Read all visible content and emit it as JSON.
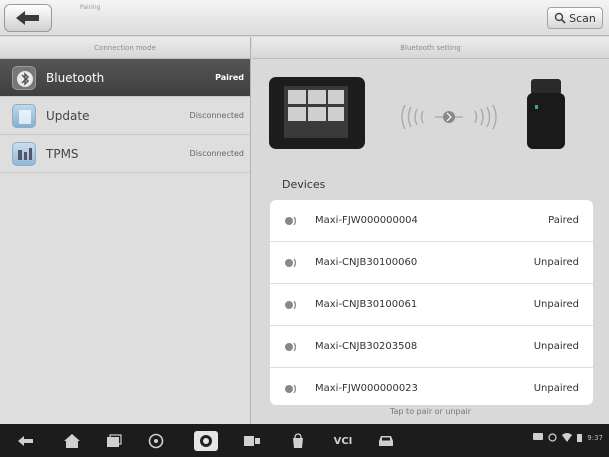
{
  "header": {
    "title": "Pairing",
    "scan_label": "Scan"
  },
  "left_panel": {
    "column_title": "Connection mode",
    "items": [
      {
        "label": "Bluetooth",
        "status": "Paired",
        "icon": "bluetooth-icon",
        "active": true
      },
      {
        "label": "Update",
        "status": "Disconnected",
        "icon": "update-icon",
        "active": false
      },
      {
        "label": "TPMS",
        "status": "Disconnected",
        "icon": "tpms-icon",
        "active": false
      }
    ]
  },
  "right_panel": {
    "column_title": "Bluetooth setting",
    "devices_label": "Devices",
    "devices": [
      {
        "name": "Maxi-FJW000000004",
        "status": "Paired"
      },
      {
        "name": "Maxi-CNJB30100060",
        "status": "Unpaired"
      },
      {
        "name": "Maxi-CNJB30100061",
        "status": "Unpaired"
      },
      {
        "name": "Maxi-CNJB30203508",
        "status": "Unpaired"
      },
      {
        "name": "Maxi-FJW000000023",
        "status": "Unpaired"
      }
    ],
    "hint": "Tap to pair or unpair"
  },
  "navbar": {
    "vci_label": "VCI",
    "time": "9:37"
  },
  "colors": {
    "active_item_bg": "#4a4a4a",
    "navbar_bg": "#1c1c1c",
    "panel_bg": "#d9d9d9"
  }
}
